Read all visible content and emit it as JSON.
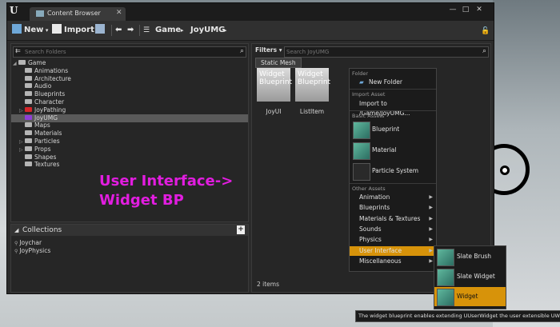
{
  "window": {
    "tab_title": "Content Browser",
    "minimize": "—",
    "maximize": "□",
    "close": "✕"
  },
  "toolbar": {
    "new_label": "New",
    "import_label": "Import",
    "breadcrumb": [
      "Game",
      "JoyUMG"
    ],
    "breadcrumb_sep": "▸"
  },
  "sources": {
    "search_placeholder": "Search Folders",
    "tree": [
      {
        "label": "Game",
        "depth": 0,
        "expanded": true,
        "color": "#b5b5b5"
      },
      {
        "label": "Animations",
        "depth": 1,
        "color": "#b5b5b5"
      },
      {
        "label": "Architecture",
        "depth": 1,
        "color": "#b5b5b5"
      },
      {
        "label": "Audio",
        "depth": 1,
        "color": "#b5b5b5"
      },
      {
        "label": "Blueprints",
        "depth": 1,
        "color": "#b5b5b5"
      },
      {
        "label": "Character",
        "depth": 1,
        "color": "#b5b5b5"
      },
      {
        "label": "JoyPathing",
        "depth": 1,
        "collapsed": true,
        "color": "#d6262a"
      },
      {
        "label": "JoyUMG",
        "depth": 1,
        "selected": true,
        "color": "#8e3fd6"
      },
      {
        "label": "Maps",
        "depth": 1,
        "color": "#b5b5b5"
      },
      {
        "label": "Materials",
        "depth": 1,
        "color": "#b5b5b5"
      },
      {
        "label": "Particles",
        "depth": 1,
        "collapsed": true,
        "color": "#b5b5b5"
      },
      {
        "label": "Props",
        "depth": 1,
        "collapsed": true,
        "color": "#b5b5b5"
      },
      {
        "label": "Shapes",
        "depth": 1,
        "color": "#b5b5b5"
      },
      {
        "label": "Textures",
        "depth": 1,
        "color": "#b5b5b5"
      }
    ]
  },
  "annotation": {
    "line1": "User Interface->",
    "line2": "Widget BP"
  },
  "collections": {
    "title": "Collections",
    "add": "+",
    "items": [
      "Joychar",
      "JoyPhysics"
    ]
  },
  "assets": {
    "filters_label": "Filters",
    "search_placeholder": "Search JoyUMG",
    "filter_chip": "Static Mesh",
    "items": [
      {
        "thumb": "Widget Blueprint",
        "label": "JoyUI"
      },
      {
        "thumb": "Widget Blueprint",
        "label": "ListItem"
      }
    ],
    "count": "2 items"
  },
  "context_menu": {
    "folder_header": "Folder",
    "new_folder": "New Folder",
    "import_header": "Import Asset",
    "import_to": "Import to /Game/JoyUMG...",
    "basic_header": "Basic Assets",
    "basic_items": [
      "Blueprint",
      "Material",
      "Particle System"
    ],
    "other_header": "Other Assets",
    "other_items": [
      "Animation",
      "Blueprints",
      "Materials & Textures",
      "Sounds",
      "Physics",
      "User Interface",
      "Miscellaneous"
    ],
    "highlight_color": "#d7930a"
  },
  "submenu": {
    "items": [
      "Slate Brush",
      "Slate Widget Style",
      "Widget Blueprint"
    ]
  },
  "tooltip": "The widget blueprint enables extending UUserWidget the user extensible UWidget."
}
